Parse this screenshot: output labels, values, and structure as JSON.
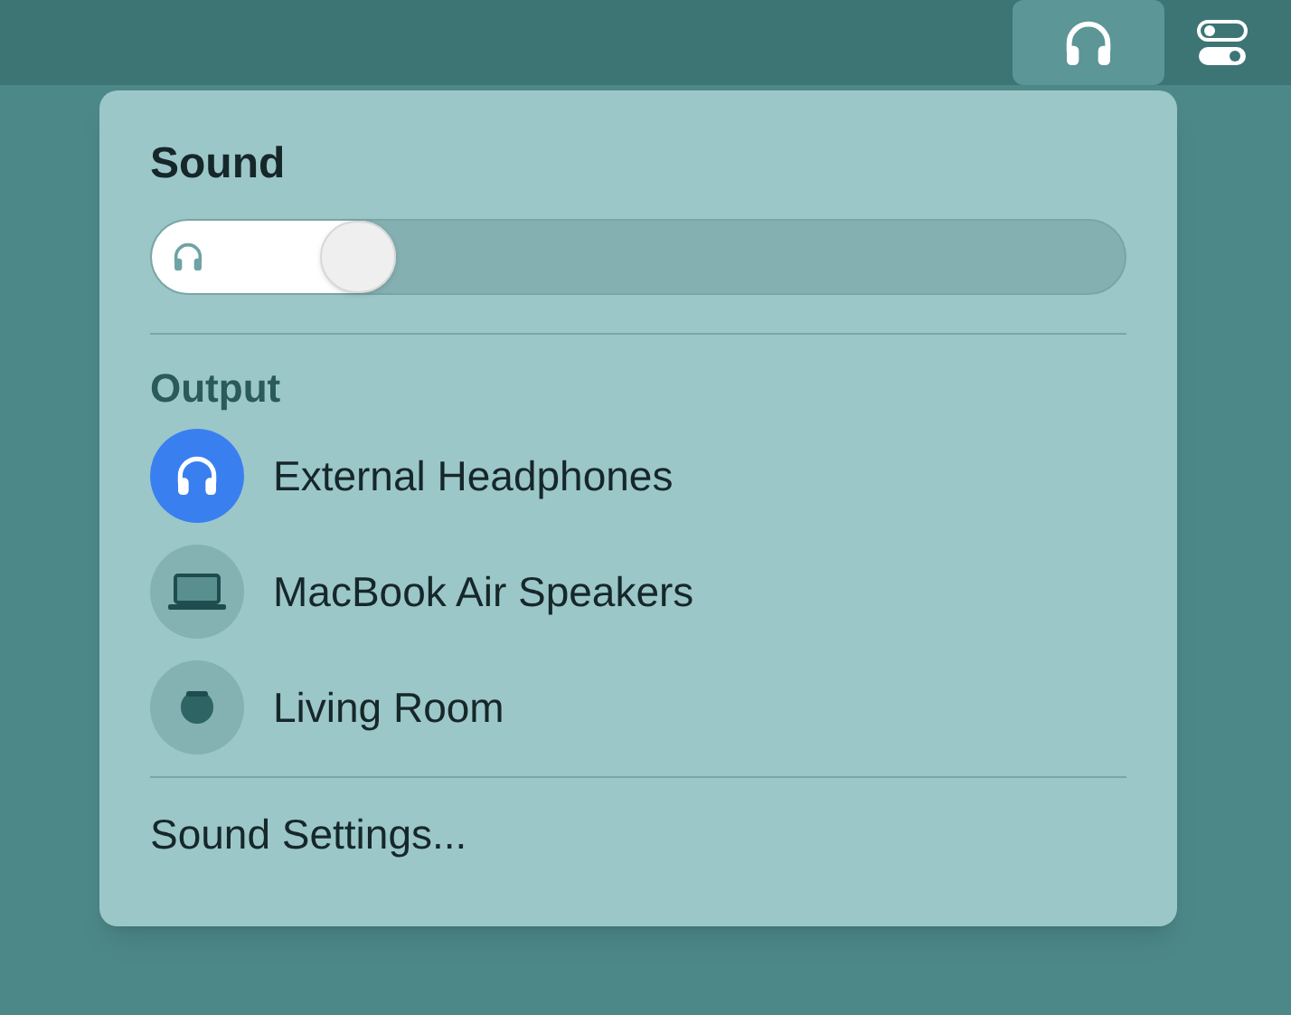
{
  "menubar": {
    "items": [
      {
        "kind": "headphones",
        "selected": true
      },
      {
        "kind": "control-center",
        "selected": false
      }
    ]
  },
  "sound": {
    "title": "Sound",
    "volume": {
      "level": 0.25
    }
  },
  "output": {
    "heading": "Output",
    "devices": [
      {
        "kind": "headphones",
        "name": "External Headphones",
        "selected": true
      },
      {
        "kind": "laptop",
        "name": "MacBook Air Speakers",
        "selected": false
      },
      {
        "kind": "speaker",
        "name": "Living Room",
        "selected": false
      }
    ]
  },
  "settings_link": "Sound Settings..."
}
